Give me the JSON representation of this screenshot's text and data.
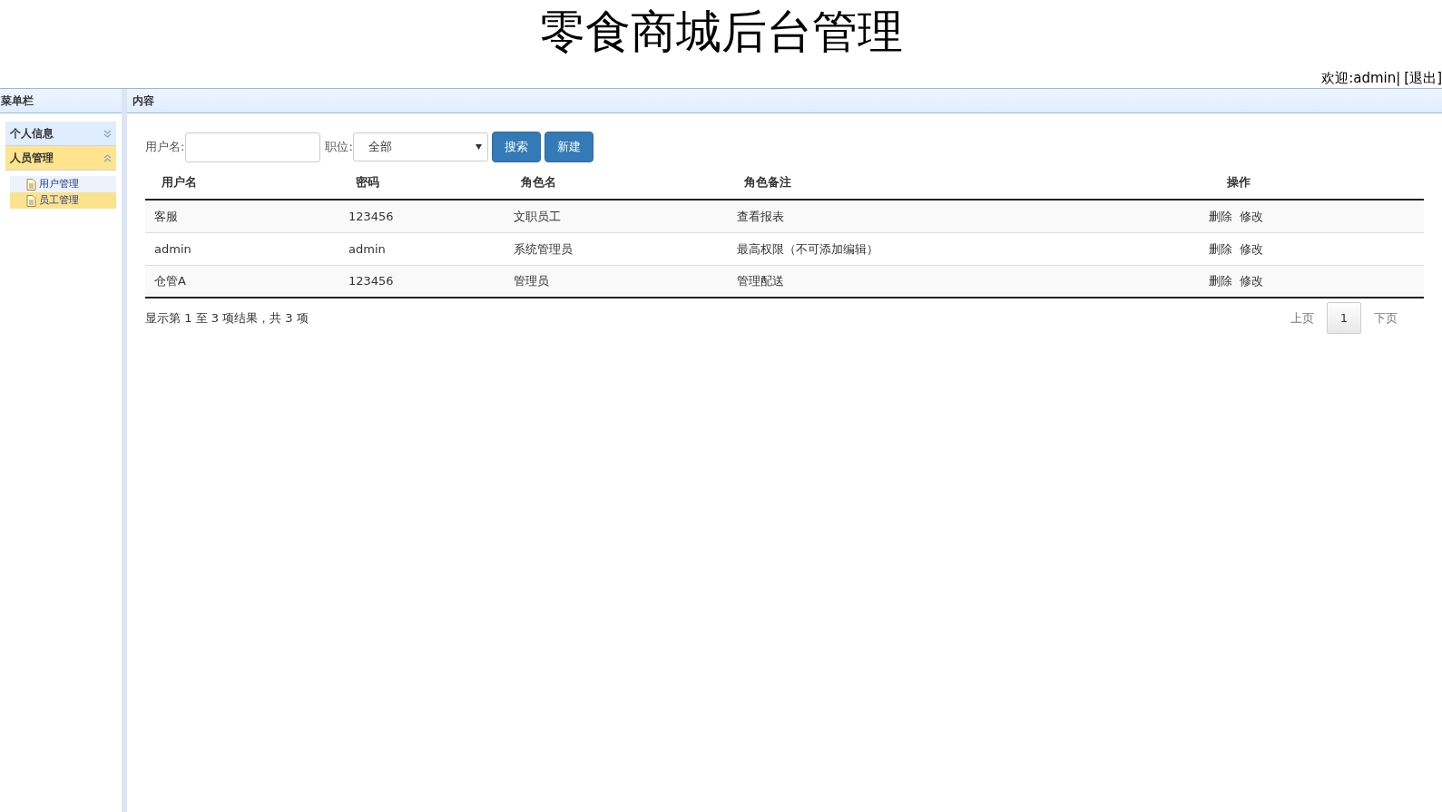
{
  "header": {
    "title": "零食商城后台管理",
    "welcome": "欢迎:admin|",
    "logout": "[退出]"
  },
  "sidebar": {
    "title": "菜单栏",
    "sections": [
      {
        "label": "个人信息",
        "expanded": false
      },
      {
        "label": "人员管理",
        "expanded": true,
        "items": [
          {
            "label": "用户管理",
            "selected": false
          },
          {
            "label": "员工管理",
            "selected": true
          }
        ]
      }
    ]
  },
  "content": {
    "title": "内容",
    "filters": {
      "username_label": "用户名:",
      "role_label": "职位:",
      "role_value": "全部",
      "buttons": [
        "搜索",
        "新建"
      ]
    },
    "table": {
      "columns": [
        "用户名",
        "密码",
        "角色名",
        "角色备注",
        "操作"
      ],
      "rows": [
        {
          "cells": [
            "客服",
            "123456",
            "文职员工",
            "查看报表"
          ],
          "actions": [
            "删除",
            "修改"
          ]
        },
        {
          "cells": [
            "admin",
            "admin",
            "系统管理员",
            "最高权限（不可添加编辑）"
          ],
          "actions": [
            "删除",
            "修改"
          ]
        },
        {
          "cells": [
            "仓管A",
            "123456",
            "管理员",
            "管理配送"
          ],
          "actions": [
            "删除",
            "修改"
          ]
        }
      ]
    },
    "summary": "显示第 1 至 3 项结果，共 3 项",
    "pagination": {
      "prev": "上页",
      "pages": [
        {
          "label": "1",
          "selected": true
        }
      ],
      "next": "下页"
    }
  }
}
